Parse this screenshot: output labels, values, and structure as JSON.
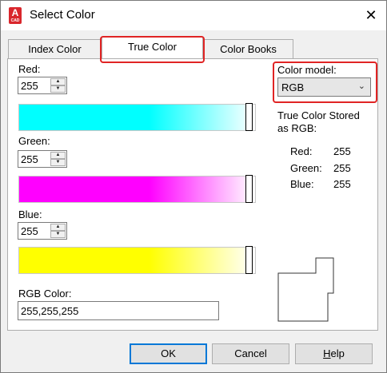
{
  "window": {
    "title": "Select Color",
    "app_icon_letter": "A",
    "app_icon_sub": "CAD",
    "close_symbol": "✕"
  },
  "tabs": [
    {
      "label": "Index Color",
      "active": false
    },
    {
      "label": "True Color",
      "active": true
    },
    {
      "label": "Color Books",
      "active": false
    }
  ],
  "red": {
    "label": "Red:",
    "value": "255",
    "gradient_color": "#00ffff",
    "slider_level": 1.0
  },
  "green": {
    "label": "Green:",
    "value": "255",
    "gradient_color": "#ff00ff",
    "slider_level": 1.0
  },
  "blue": {
    "label": "Blue:",
    "value": "255",
    "gradient_color": "#ffff00",
    "slider_level": 1.0
  },
  "color_model": {
    "label": "Color model:",
    "value": "RGB"
  },
  "stored": {
    "heading": "True Color Stored as RGB:",
    "red_label": "Red:",
    "red_value": "255",
    "green_label": "Green:",
    "green_value": "255",
    "blue_label": "Blue:",
    "blue_value": "255"
  },
  "rgb_color": {
    "label": "RGB Color:",
    "value": "255,255,255"
  },
  "preview": {
    "current_color": "#ffffff",
    "previous_color": "#ffffff"
  },
  "buttons": {
    "ok": "OK",
    "cancel": "Cancel",
    "help_first": "H",
    "help_rest": "elp"
  },
  "colors": {
    "highlight": "#e02424",
    "default_button_border": "#0078d7"
  }
}
